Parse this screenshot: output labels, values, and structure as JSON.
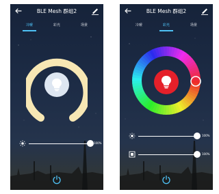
{
  "screens": [
    {
      "header": {
        "title": "BLE Mesh 群组2"
      },
      "tabs": [
        {
          "label": "冷暖",
          "active": true
        },
        {
          "label": "彩光",
          "active": false
        },
        {
          "label": "场景",
          "active": false
        }
      ],
      "brightness_slider": {
        "value": "100%",
        "level": 1.0
      }
    },
    {
      "header": {
        "title": "BLE Mesh 群组2"
      },
      "tabs": [
        {
          "label": "冷暖",
          "active": false
        },
        {
          "label": "彩光",
          "active": true
        },
        {
          "label": "场景",
          "active": false
        }
      ],
      "brightness_slider": {
        "value": "100%",
        "level": 1.0
      },
      "saturation_slider": {
        "value": "100%",
        "level": 1.0
      },
      "selected_color": "#e5202a"
    }
  ],
  "colors": {
    "accent": "#4fc3f7",
    "warm_ring": "#f9eab8",
    "bulb_cool_bg": "#dfe7f2",
    "bulb_red_bg": "#e5202a"
  },
  "icons": [
    "back-icon",
    "edit-icon",
    "bulb-icon",
    "sun-icon",
    "saturation-icon",
    "power-icon"
  ]
}
